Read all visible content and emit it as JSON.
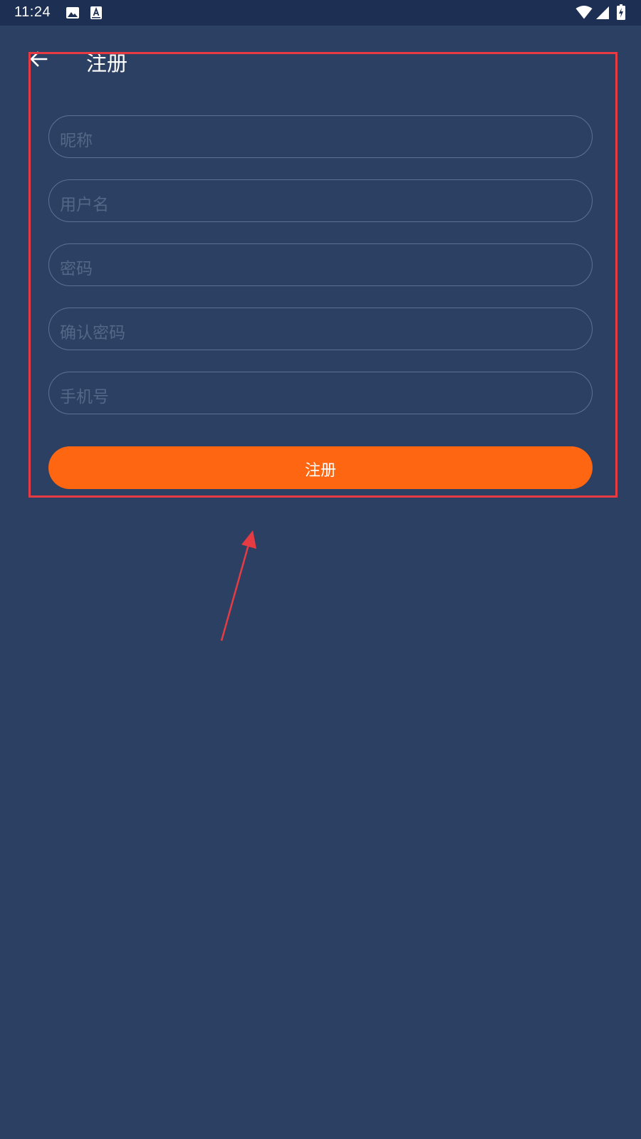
{
  "status_bar": {
    "time": "11:24",
    "icons": [
      "image-icon",
      "keyboard-a-icon",
      "wifi-icon",
      "signal-icon",
      "battery-charging-icon"
    ]
  },
  "app_bar": {
    "back_icon": "arrow-left-icon",
    "title": "注册"
  },
  "form": {
    "fields": [
      {
        "placeholder": "昵称",
        "value": ""
      },
      {
        "placeholder": "用户名",
        "value": ""
      },
      {
        "placeholder": "密码",
        "value": ""
      },
      {
        "placeholder": "确认密码",
        "value": ""
      },
      {
        "placeholder": "手机号",
        "value": ""
      }
    ],
    "submit_label": "注册"
  },
  "annotation": {
    "highlight_color": "#e63b43"
  },
  "colors": {
    "background": "#2c4063",
    "status_bar": "#1d3053",
    "accent": "#ff6611",
    "field_border": "#5c7294",
    "placeholder": "#546787"
  }
}
